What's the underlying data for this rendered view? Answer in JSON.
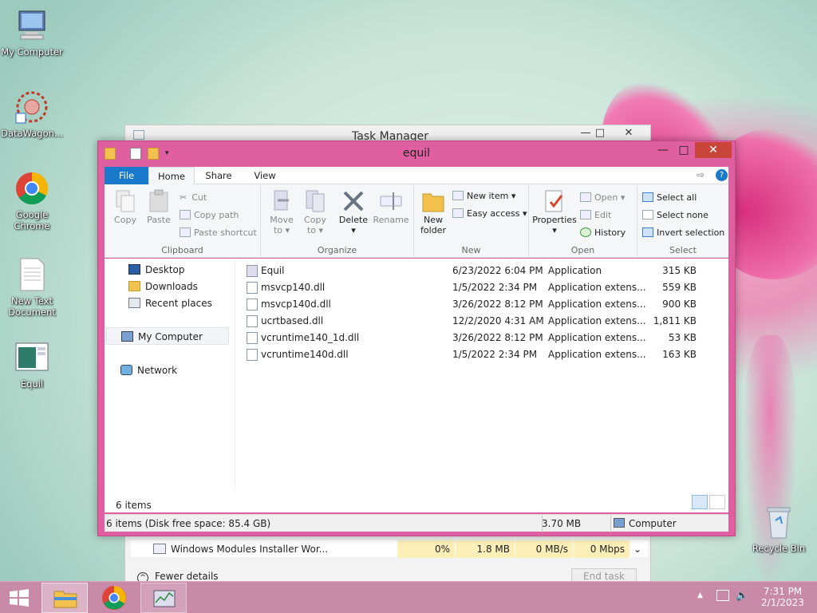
{
  "desktop": {
    "icons": [
      {
        "label": "My Computer",
        "icon": "computer-icon"
      },
      {
        "label": "DataWagon...",
        "icon": "datawagon-icon"
      },
      {
        "label": "Google Chrome",
        "icon": "chrome-icon"
      },
      {
        "label": "New Text Document",
        "icon": "text-document-icon"
      },
      {
        "label": "Equil",
        "icon": "equil-app-icon"
      },
      {
        "label": "Recycle Bin",
        "icon": "recycle-bin-icon"
      }
    ]
  },
  "task_manager": {
    "title": "Task Manager",
    "row": {
      "name": "Windows Modules Installer Wor...",
      "cpu": "0%",
      "memory": "1.8 MB",
      "disk": "0 MB/s",
      "network": "0 Mbps"
    },
    "fewer_details": "Fewer details",
    "end_task": "End task"
  },
  "explorer": {
    "title": "equil",
    "tabs": [
      "File",
      "Home",
      "Share",
      "View"
    ],
    "ribbon": {
      "clipboard": {
        "label": "Clipboard",
        "copy": "Copy",
        "paste": "Paste",
        "cut": "Cut",
        "copy_path": "Copy path",
        "paste_shortcut": "Paste shortcut"
      },
      "organize": {
        "label": "Organize",
        "move_to": "Move",
        "move_to2": "to",
        "copy_to": "Copy",
        "copy_to2": "to",
        "delete": "Delete",
        "rename": "Rename"
      },
      "new": {
        "label": "New",
        "new_folder": "New",
        "new_folder2": "folder",
        "new_item": "New item",
        "easy_access": "Easy access"
      },
      "open": {
        "label": "Open",
        "properties": "Properties",
        "open": "Open",
        "edit": "Edit",
        "history": "History"
      },
      "select": {
        "label": "Select",
        "select_all": "Select all",
        "select_none": "Select none",
        "invert": "Invert selection"
      }
    },
    "nav": {
      "desktop": "Desktop",
      "downloads": "Downloads",
      "recent": "Recent places",
      "my_computer": "My Computer",
      "network": "Network"
    },
    "files": [
      {
        "name": "Equil",
        "date": "6/23/2022 6:04 PM",
        "type": "Application",
        "size": "315 KB"
      },
      {
        "name": "msvcp140.dll",
        "date": "1/5/2022 2:34 PM",
        "type": "Application extens...",
        "size": "559 KB"
      },
      {
        "name": "msvcp140d.dll",
        "date": "3/26/2022 8:12 PM",
        "type": "Application extens...",
        "size": "900 KB"
      },
      {
        "name": "ucrtbased.dll",
        "date": "12/2/2020 4:31 AM",
        "type": "Application extens...",
        "size": "1,811 KB"
      },
      {
        "name": "vcruntime140_1d.dll",
        "date": "3/26/2022 8:12 PM",
        "type": "Application extens...",
        "size": "53 KB"
      },
      {
        "name": "vcruntime140d.dll",
        "date": "1/5/2022 2:34 PM",
        "type": "Application extens...",
        "size": "163 KB"
      }
    ],
    "item_count": "6 items",
    "status": {
      "left": "6 items (Disk free space: 85.4 GB)",
      "size": "3.70 MB",
      "location": "Computer"
    }
  },
  "taskbar": {
    "time": "7:31 PM",
    "date": "2/1/2023"
  },
  "colors": {
    "window_frame": "#e05fa0",
    "file_tab": "#1979ca",
    "close": "#c9453a",
    "taskbar": "#c98aa8"
  }
}
